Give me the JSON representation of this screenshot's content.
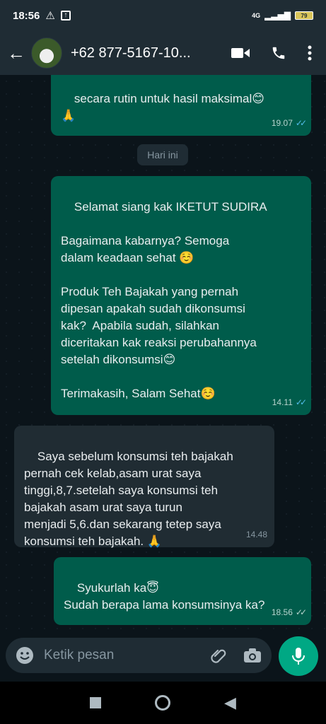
{
  "status": {
    "time": "18:56",
    "network": "4G",
    "battery": "79"
  },
  "header": {
    "contact": "+62 877-5167-10..."
  },
  "chat": {
    "messages": [
      {
        "side": "out",
        "text": "secara rutin untuk hasil maksimal😊\n🙏",
        "time": "19.07",
        "read": true
      },
      {
        "side": "day",
        "text": "Hari ini"
      },
      {
        "side": "out",
        "text": "Selamat siang kak IKETUT SUDIRA\n\nBagaimana kabarnya? Semoga\ndalam keadaan sehat ☺️\n\nProduk Teh Bajakah yang pernah\ndipesan apakah sudah dikonsumsi\nkak?  Apabila sudah, silahkan\ndiceritakan kak reaksi perubahannya\nsetelah dikonsumsi😊\n\nTerimakasih, Salam Sehat☺️",
        "time": "14.11",
        "read": true
      },
      {
        "side": "in",
        "text": "Saya sebelum konsumsi teh bajakah\npernah cek kelab,asam urat saya\ntinggi,8,7.setelah saya konsumsi teh\nbajakah asam urat saya turun\nmenjadi 5,6.dan sekarang tetep saya\nkonsumsi teh bajakah. 🙏",
        "time": "14.48"
      },
      {
        "side": "out",
        "text": "Syukurlah ka😇\nSudah berapa lama konsumsinya ka?",
        "time": "18.56",
        "read": false
      }
    ]
  },
  "input": {
    "placeholder": "Ketik pesan"
  },
  "icons": {
    "accent": "#00a884",
    "bubble_out": "#005c4b",
    "bubble_in": "#202c33"
  }
}
